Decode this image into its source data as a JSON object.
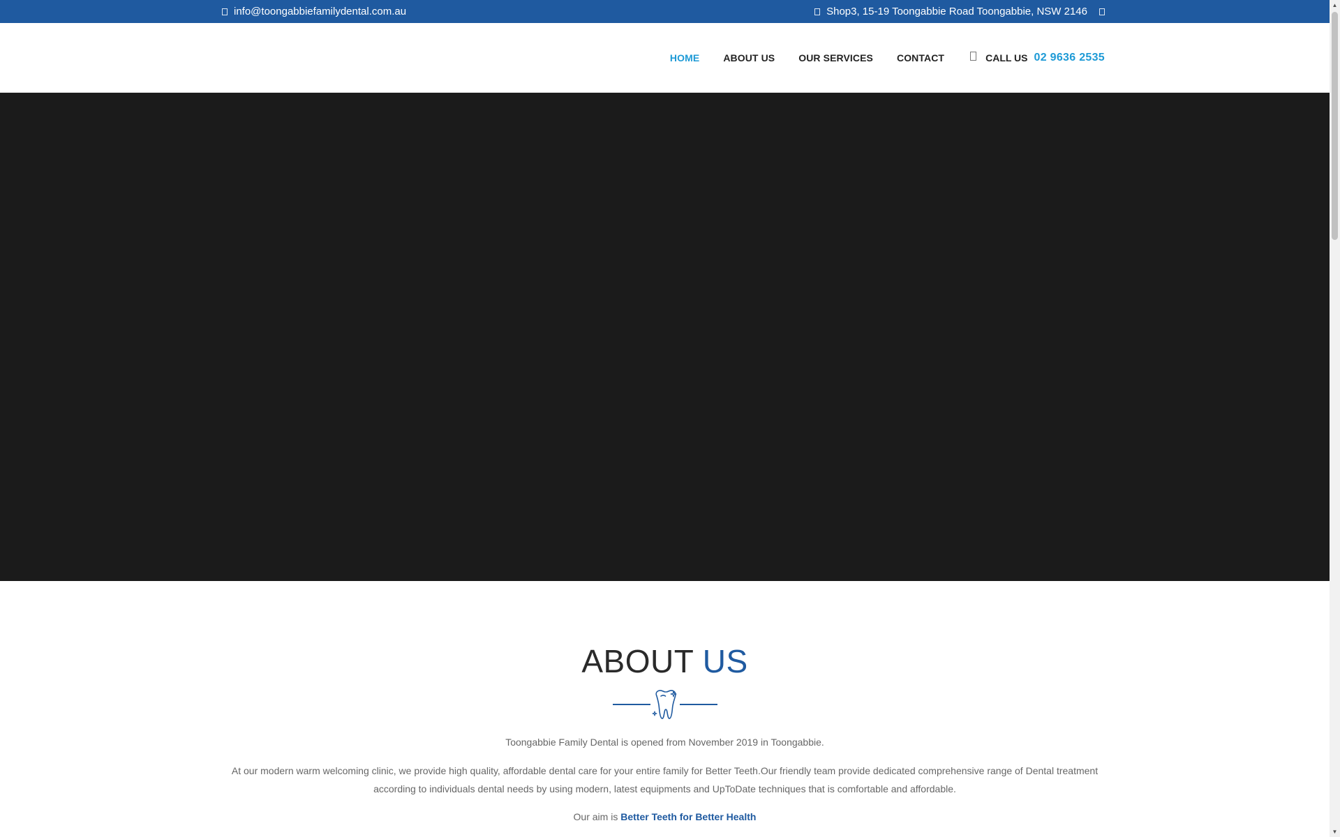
{
  "topbar": {
    "email": "info@toongabbiefamilydental.com.au",
    "address": "Shop3, 15-19 Toongabbie Road Toongabbie, NSW 2146",
    "email_icon": "envelope-icon",
    "address_icon": "map-marker-icon",
    "social_icon": "facebook-icon"
  },
  "nav": {
    "items": [
      {
        "label": "HOME",
        "active": true
      },
      {
        "label": "ABOUT US",
        "active": false
      },
      {
        "label": "OUR SERVICES",
        "active": false
      },
      {
        "label": "CONTACT",
        "active": false
      }
    ],
    "call_label": "CALL US",
    "call_number": "02 9636 2535",
    "call_icon": "mobile-phone-icon"
  },
  "about": {
    "title_main": "ABOUT",
    "title_accent": "US",
    "divider_icon": "tooth-icon",
    "p1": "Toongabbie Family Dental is opened from November 2019 in Toongabbie.",
    "p2": "At our modern warm welcoming clinic, we provide high quality, affordable dental care for your entire family for Better Teeth.Our friendly team provide dedicated comprehensive range of Dental treatment according to individuals dental needs by using modern, latest equipments and UpToDate techniques that is comfortable and affordable.",
    "aim_prefix": "Our aim is",
    "aim_strong": "Better Teeth for Better Health"
  },
  "colors": {
    "topbar_bg": "#1f5aa0",
    "nav_active": "#1d9ad6",
    "accent_blue": "#1f5aa0",
    "hero_bg": "#1b1b1b"
  }
}
